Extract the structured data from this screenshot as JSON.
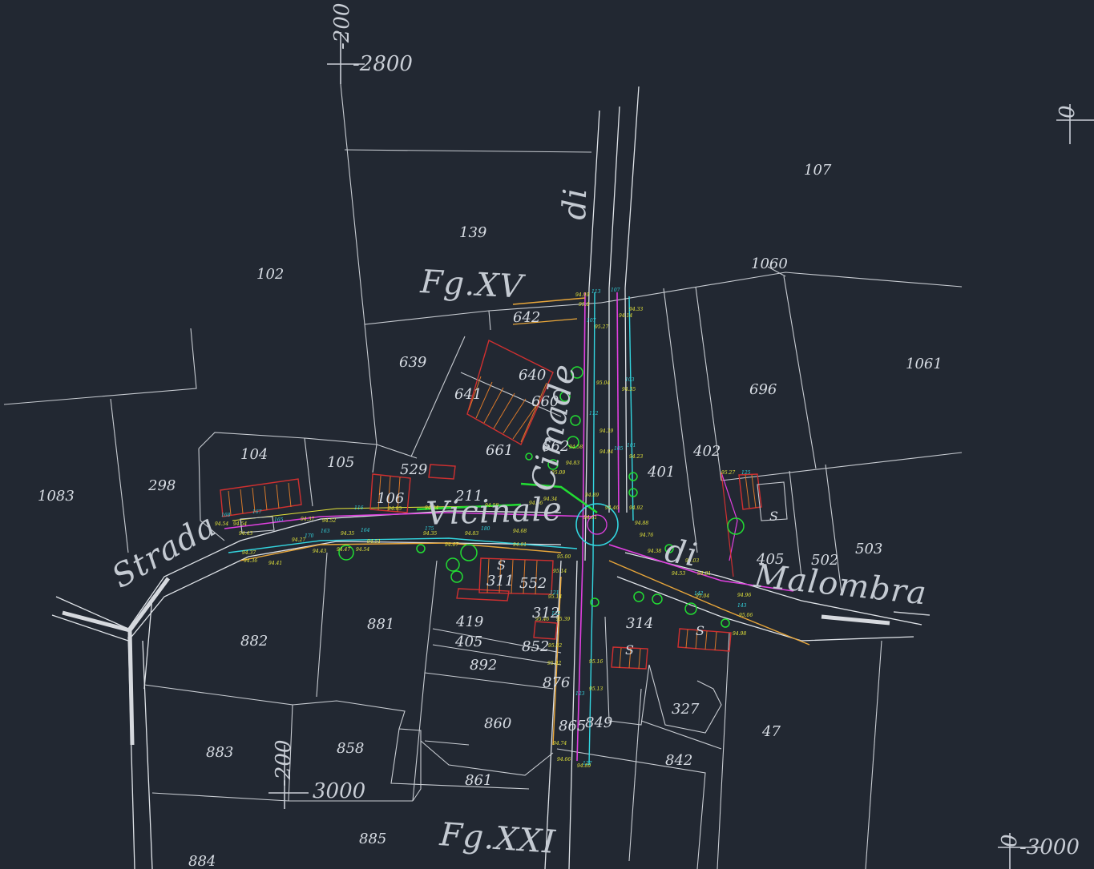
{
  "drawing": {
    "colors": {
      "background": "#222832",
      "linework": "#c8ccd2",
      "magenta": "#e040e0",
      "cyan": "#33d6e0",
      "yellow": "#e8e83a",
      "green": "#22dd33",
      "red": "#d03030",
      "orange": "#e89a2a"
    },
    "sheet_labels": [
      "Fg.XV",
      "Fg.XXI"
    ],
    "street_labels": [
      "Strada",
      "Vicinale",
      "Cimade",
      "di",
      "Malombra",
      "di"
    ],
    "grid_labels": [
      "-2800",
      "-200",
      "-200",
      "3000",
      "-3000",
      "0",
      "0"
    ],
    "parcels": [
      "107",
      "139",
      "102",
      "1060",
      "642",
      "639",
      "640",
      "641",
      "660",
      "696",
      "1061",
      "104",
      "105",
      "529",
      "106",
      "211",
      "661",
      "662",
      "402",
      "401",
      "1083",
      "298",
      "405",
      "502",
      "503",
      "311",
      "552",
      "881",
      "882",
      "419",
      "405",
      "312",
      "314",
      "852",
      "892",
      "876",
      "860",
      "865",
      "849",
      "327",
      "47",
      "883",
      "858",
      "842",
      "861",
      "885",
      "884"
    ],
    "building_marks": [
      "S",
      "S",
      "S",
      "S"
    ]
  }
}
